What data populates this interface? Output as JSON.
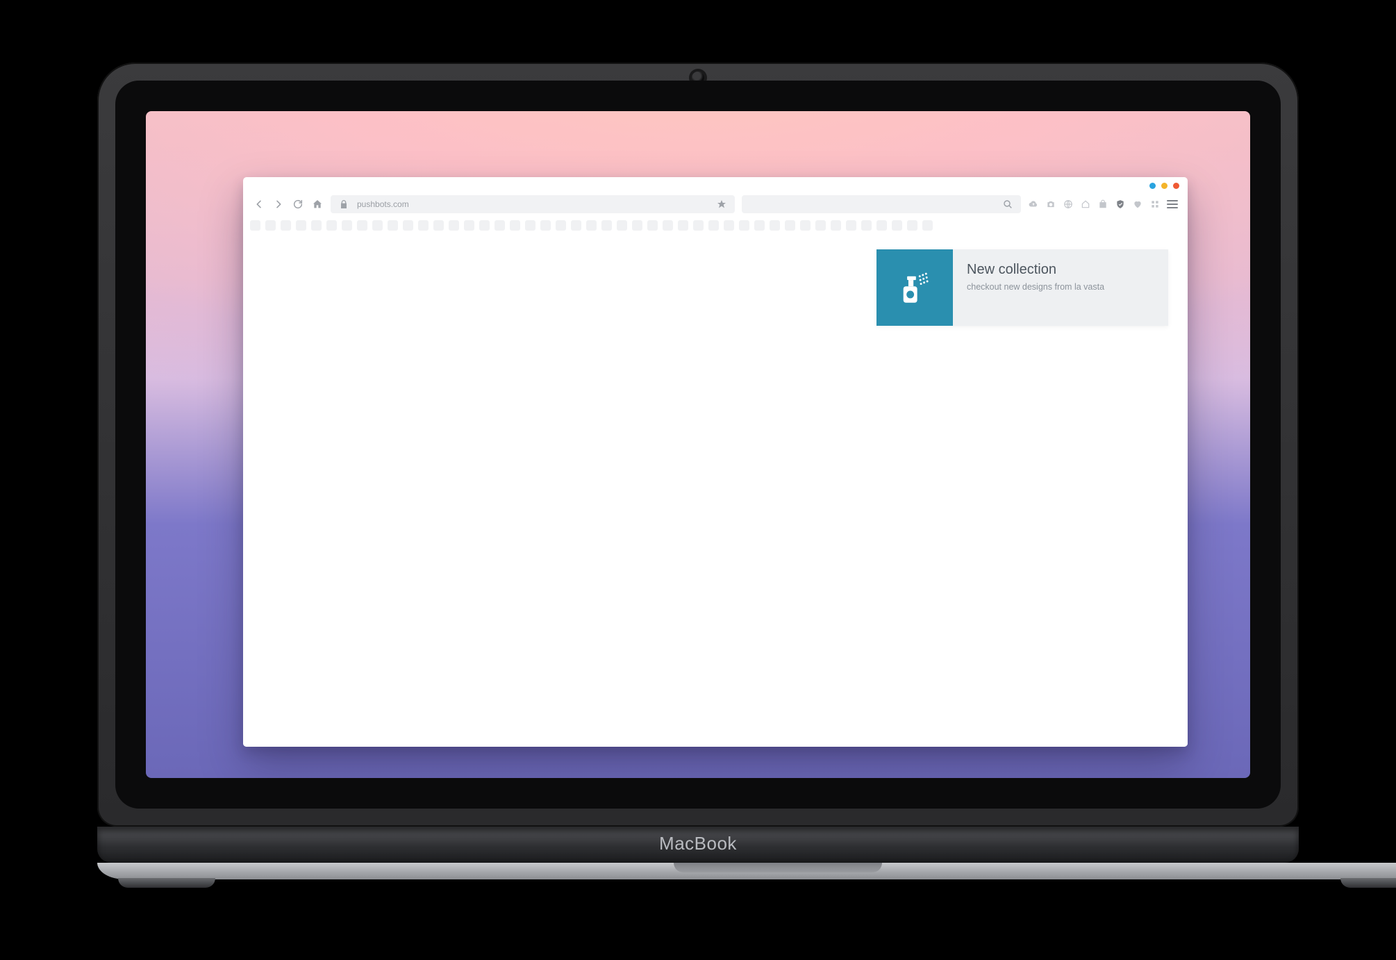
{
  "device": {
    "brand": "MacBook"
  },
  "window_controls": {
    "blue": "#2aa3df",
    "yellow": "#f4b42a",
    "red": "#ef5a34"
  },
  "browser": {
    "address": {
      "url": "pushbots.com"
    },
    "search": {
      "placeholder": ""
    }
  },
  "bookmarks": {
    "count": 45
  },
  "toolbar_icons": [
    "cloud-upload-icon",
    "camera-icon",
    "globe-icon",
    "home-outline-icon",
    "bag-icon",
    "shield-check-icon",
    "heart-icon",
    "grid-icon"
  ],
  "notification": {
    "title": "New collection",
    "message": "checkout new designs from la vasta",
    "accent": "#2a8faf",
    "icon": "spray-bottle-icon"
  }
}
